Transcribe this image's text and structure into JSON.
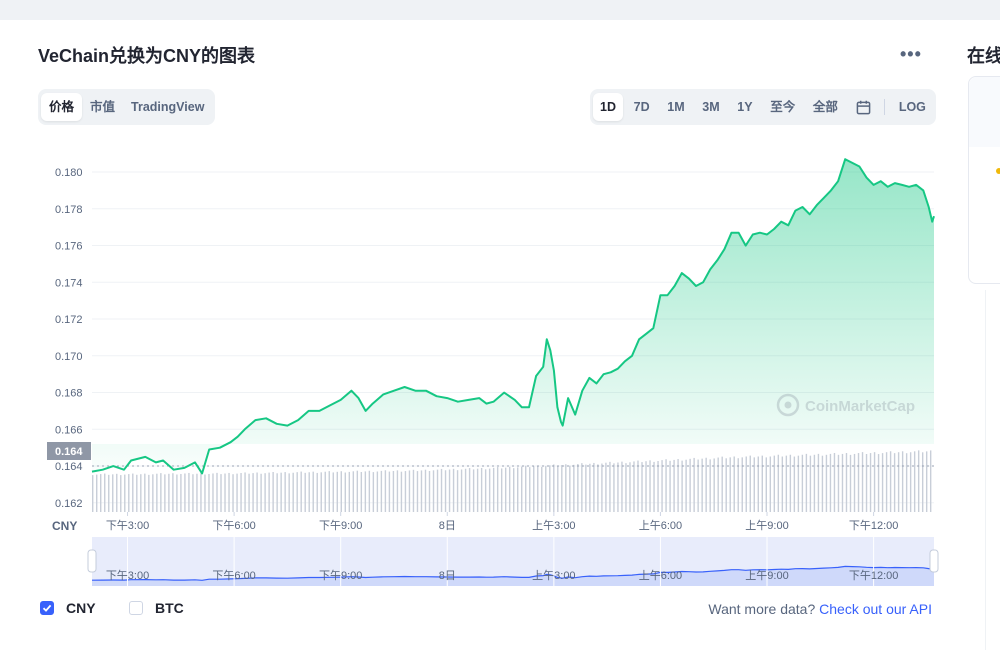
{
  "page": {
    "title": "VeChain兑换为CNY的图表",
    "side_title": "在线"
  },
  "tabs_left": [
    {
      "label": "价格",
      "active": true
    },
    {
      "label": "市值",
      "active": false
    },
    {
      "label": "TradingView",
      "active": false
    }
  ],
  "tabs_right": [
    {
      "label": "1D",
      "active": true
    },
    {
      "label": "7D",
      "active": false
    },
    {
      "label": "1M",
      "active": false
    },
    {
      "label": "3M",
      "active": false
    },
    {
      "label": "1Y",
      "active": false
    },
    {
      "label": "至今",
      "active": false
    },
    {
      "label": "全部",
      "active": false
    }
  ],
  "scale_toggle": "LOG",
  "icons": {
    "calendar": "calendar-icon",
    "more": "more-horizontal-icon",
    "check": "check-icon",
    "watermark": "coinmarketcap-logo"
  },
  "watermark": "CoinMarketCap",
  "currency_label": "CNY",
  "current_price_label": "0.164",
  "colors": {
    "line": "#16c784",
    "below_open": "#ea3943",
    "accent": "#3861fb",
    "navigator_line": "#3861fb",
    "navigator_fill": "#dfe6fd"
  },
  "chart_data": {
    "type": "area",
    "y_ticks": [
      "0.180",
      "0.178",
      "0.176",
      "0.174",
      "0.172",
      "0.170",
      "0.168",
      "0.166",
      "0.164",
      "0.162"
    ],
    "ylim": [
      0.1615,
      0.1812
    ],
    "x_ticks": [
      {
        "t": 3,
        "label": "下午3:00"
      },
      {
        "t": 6,
        "label": "下午6:00"
      },
      {
        "t": 9,
        "label": "下午9:00"
      },
      {
        "t": 12,
        "label": "8日"
      },
      {
        "t": 15,
        "label": "上午3:00"
      },
      {
        "t": 18,
        "label": "上午6:00"
      },
      {
        "t": 21,
        "label": "上午9:00"
      },
      {
        "t": 24,
        "label": "下午12:00"
      }
    ],
    "xlim": [
      2.0,
      25.7
    ],
    "open_price": 0.164,
    "series": [
      {
        "values": [
          [
            2.0,
            0.1637
          ],
          [
            2.3,
            0.1638
          ],
          [
            2.6,
            0.164
          ],
          [
            2.9,
            0.1638
          ],
          [
            3.1,
            0.1643
          ],
          [
            3.5,
            0.1645
          ],
          [
            3.8,
            0.1642
          ],
          [
            4.0,
            0.1643
          ],
          [
            4.3,
            0.1638
          ],
          [
            4.6,
            0.1639
          ],
          [
            4.9,
            0.1642
          ],
          [
            5.1,
            0.1636
          ],
          [
            5.3,
            0.1649
          ],
          [
            5.6,
            0.165
          ],
          [
            5.9,
            0.1653
          ],
          [
            6.1,
            0.1656
          ],
          [
            6.3,
            0.166
          ],
          [
            6.6,
            0.1665
          ],
          [
            6.9,
            0.1666
          ],
          [
            7.2,
            0.1663
          ],
          [
            7.5,
            0.1662
          ],
          [
            7.8,
            0.1665
          ],
          [
            8.1,
            0.167
          ],
          [
            8.4,
            0.167
          ],
          [
            8.7,
            0.1673
          ],
          [
            9.0,
            0.1676
          ],
          [
            9.3,
            0.1681
          ],
          [
            9.5,
            0.1677
          ],
          [
            9.7,
            0.167
          ],
          [
            9.9,
            0.1674
          ],
          [
            10.2,
            0.1679
          ],
          [
            10.5,
            0.1681
          ],
          [
            10.8,
            0.1683
          ],
          [
            11.1,
            0.1681
          ],
          [
            11.4,
            0.1681
          ],
          [
            11.7,
            0.1678
          ],
          [
            12.0,
            0.1677
          ],
          [
            12.3,
            0.1675
          ],
          [
            12.6,
            0.1676
          ],
          [
            12.9,
            0.1677
          ],
          [
            13.1,
            0.1674
          ],
          [
            13.3,
            0.1675
          ],
          [
            13.6,
            0.168
          ],
          [
            13.9,
            0.1676
          ],
          [
            14.1,
            0.1672
          ],
          [
            14.3,
            0.1672
          ],
          [
            14.5,
            0.1689
          ],
          [
            14.7,
            0.1694
          ],
          [
            14.8,
            0.1709
          ],
          [
            14.9,
            0.1703
          ],
          [
            15.0,
            0.1692
          ],
          [
            15.1,
            0.1672
          ],
          [
            15.2,
            0.1664
          ],
          [
            15.25,
            0.1662
          ],
          [
            15.4,
            0.1677
          ],
          [
            15.6,
            0.1668
          ],
          [
            15.8,
            0.1681
          ],
          [
            16.0,
            0.1688
          ],
          [
            16.2,
            0.1685
          ],
          [
            16.4,
            0.169
          ],
          [
            16.6,
            0.1691
          ],
          [
            16.8,
            0.1693
          ],
          [
            17.0,
            0.1697
          ],
          [
            17.2,
            0.17
          ],
          [
            17.4,
            0.1709
          ],
          [
            17.6,
            0.1712
          ],
          [
            17.8,
            0.1715
          ],
          [
            18.0,
            0.1733
          ],
          [
            18.2,
            0.1733
          ],
          [
            18.4,
            0.1738
          ],
          [
            18.6,
            0.1745
          ],
          [
            18.8,
            0.1742
          ],
          [
            19.0,
            0.1738
          ],
          [
            19.2,
            0.174
          ],
          [
            19.4,
            0.1747
          ],
          [
            19.6,
            0.1752
          ],
          [
            19.8,
            0.1758
          ],
          [
            20.0,
            0.1767
          ],
          [
            20.2,
            0.1767
          ],
          [
            20.4,
            0.176
          ],
          [
            20.6,
            0.1766
          ],
          [
            20.8,
            0.1767
          ],
          [
            21.0,
            0.1766
          ],
          [
            21.2,
            0.1769
          ],
          [
            21.4,
            0.1773
          ],
          [
            21.6,
            0.1771
          ],
          [
            21.8,
            0.1779
          ],
          [
            22.0,
            0.1781
          ],
          [
            22.2,
            0.1777
          ],
          [
            22.4,
            0.1782
          ],
          [
            22.6,
            0.1786
          ],
          [
            22.8,
            0.179
          ],
          [
            23.0,
            0.1795
          ],
          [
            23.2,
            0.1807
          ],
          [
            23.4,
            0.1805
          ],
          [
            23.6,
            0.1803
          ],
          [
            23.8,
            0.1797
          ],
          [
            24.0,
            0.1793
          ],
          [
            24.2,
            0.1795
          ],
          [
            24.4,
            0.1792
          ],
          [
            24.6,
            0.1794
          ],
          [
            24.8,
            0.1793
          ],
          [
            25.0,
            0.1792
          ],
          [
            25.2,
            0.1793
          ],
          [
            25.4,
            0.179
          ],
          [
            25.55,
            0.1781
          ],
          [
            25.65,
            0.1773
          ],
          [
            25.7,
            0.1776
          ]
        ]
      }
    ],
    "volume_shape": [
      0.62,
      0.62,
      0.63,
      0.63,
      0.64,
      0.65,
      0.66,
      0.67,
      0.68,
      0.7,
      0.72,
      0.75,
      0.78,
      0.81,
      0.84,
      0.87,
      0.9,
      0.92,
      0.94,
      0.96,
      0.98,
      1.0
    ],
    "grid": true,
    "legend": [
      {
        "name": "CNY",
        "checked": true
      },
      {
        "name": "BTC",
        "checked": false
      }
    ]
  },
  "footer": {
    "text": "Want more data?",
    "link": "Check out our API"
  }
}
